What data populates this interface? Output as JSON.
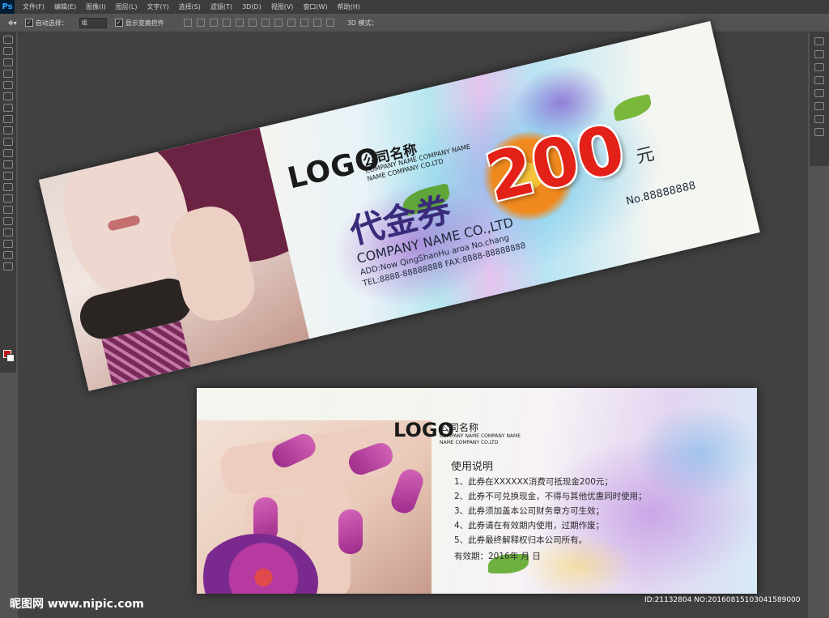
{
  "app": {
    "logo": "Ps"
  },
  "menu": {
    "items": [
      "文件(F)",
      "编辑(E)",
      "图像(I)",
      "图层(L)",
      "文字(Y)",
      "选择(S)",
      "滤镜(T)",
      "3D(D)",
      "视图(V)",
      "窗口(W)",
      "帮助(H)"
    ]
  },
  "options": {
    "auto_select_label": "自动选择：",
    "auto_select_value": "组",
    "show_transform_label": "显示变换控件",
    "mode3d_label": "3D 模式："
  },
  "voucher_front": {
    "logo": "LOGO",
    "company_cn": "公司名称",
    "company_en_line1": "COMPANY NAME COMPANY NAME",
    "company_en_line2": "NAME COMPANY CO.LTD",
    "title": "代金券",
    "amount": "200",
    "unit": "元",
    "company_name": "COMPANY NAME CO.,LTD",
    "address": "ADD:Now QingShanHu aroa No.chang",
    "tel": "TEL:8888-88888888   FAX:8888-88888888",
    "number": "No.88888888"
  },
  "voucher_back": {
    "logo": "LOGO",
    "company_cn": "公司名称",
    "company_en_line1": "COMPANY NAME COMPANY NAME",
    "company_en_line2": "NAME COMPANY CO.LTD",
    "heading": "使用说明",
    "rules": [
      "1、此券在XXXXXX消费可抵现金200元；",
      "2、此券不可兑换现金，不得与其他优惠同时使用；",
      "3、此券须加盖本公司财务章方可生效；",
      "4、此券请在有效期内使用，过期作废；",
      "5、此券最终解释权归本公司所有。"
    ],
    "validity": "有效期：2016年     月    日"
  },
  "watermark": {
    "left": "昵图网 www.nipic.com",
    "right": "ID:21132804 NO:20160815103041589000"
  },
  "colors": {
    "foreground": "#c4161c",
    "background": "#ffffff",
    "amount_red": "#e32119",
    "title_purple": "#3a2a7a"
  }
}
